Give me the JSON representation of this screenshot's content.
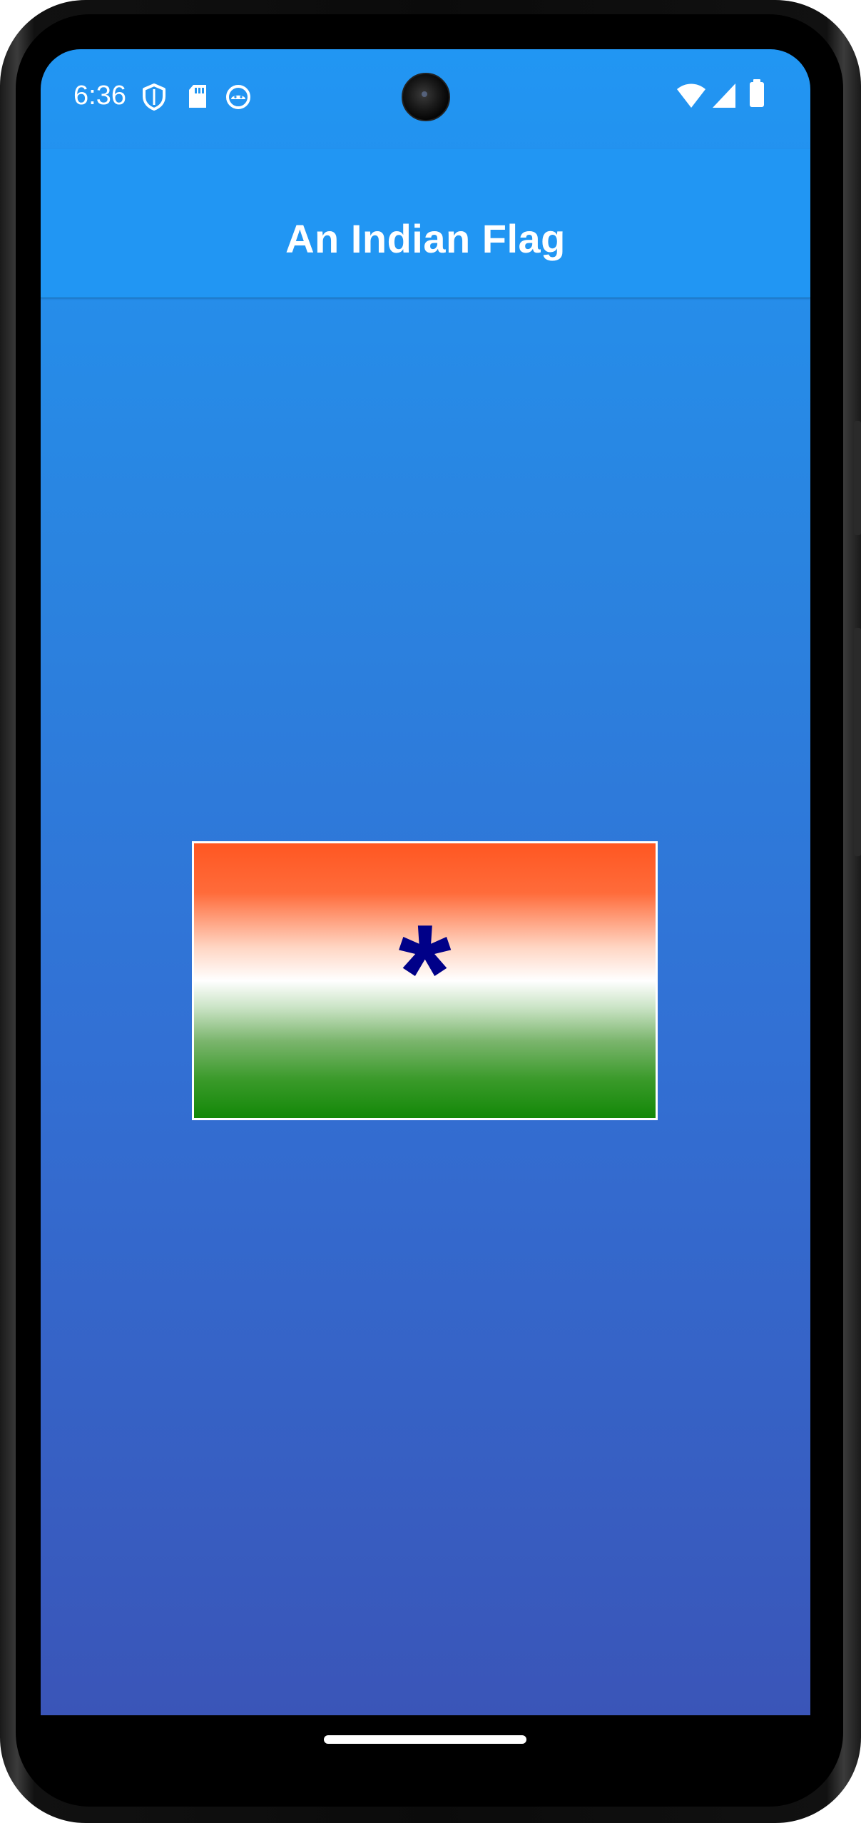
{
  "status_bar": {
    "time": "6:36",
    "left_icons": [
      "shield-icon",
      "sd-card-icon",
      "android-debug-icon"
    ],
    "right_icons": [
      "wifi-icon",
      "cellular-signal-icon",
      "battery-icon"
    ]
  },
  "app_bar": {
    "title": "An Indian Flag",
    "color": "#2196F3"
  },
  "flag": {
    "chakra_symbol": "*",
    "stripe_colors": [
      "#FF5722",
      "#FFFFFF",
      "#138808"
    ],
    "chakra_color": "#000088",
    "border_color": "#FFFFFF"
  },
  "background": {
    "gradient_top": "#2196F3",
    "gradient_bottom": "#3F51B5"
  },
  "navigation": {
    "type": "gesture-handle"
  }
}
